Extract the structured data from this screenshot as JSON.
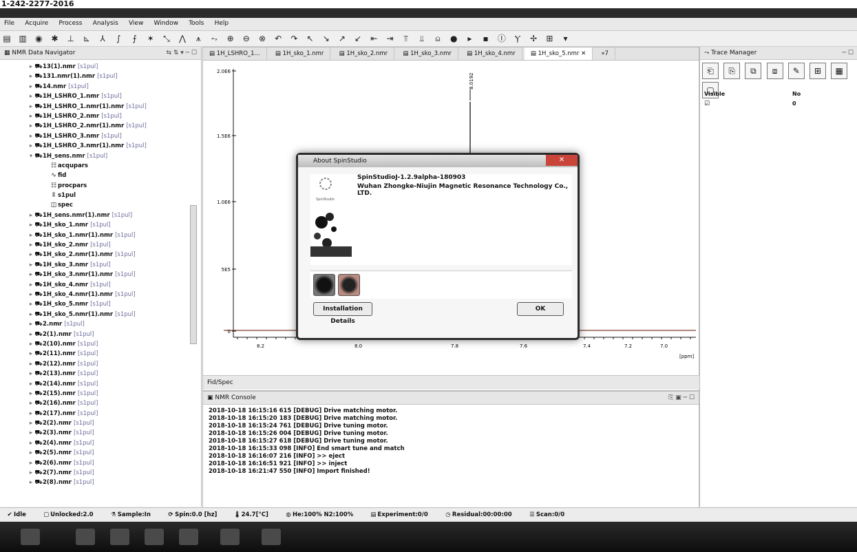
{
  "top_caption": "1-242-2277-2016",
  "menu": [
    "File",
    "Acquire",
    "Process",
    "Analysis",
    "View",
    "Window",
    "Tools",
    "Help"
  ],
  "navigator": {
    "title": "NMR Data Navigator",
    "items": [
      {
        "label": "13(1).nmr",
        "suffix": "[s1pul]",
        "icon": "spectrum-file-icon"
      },
      {
        "label": "131.nmr(1).nmr",
        "suffix": "[s1pul]",
        "icon": "spectrum-file-icon"
      },
      {
        "label": "14.nmr",
        "suffix": "[s1pul]",
        "icon": "spectrum-file-icon"
      },
      {
        "label": "1H_LSHRO_1.nmr",
        "suffix": "[s1pul]",
        "icon": "spectrum-file-icon"
      },
      {
        "label": "1H_LSHRO_1.nmr(1).nmr",
        "suffix": "[s1pul]",
        "icon": "spectrum-file-icon"
      },
      {
        "label": "1H_LSHRO_2.nmr",
        "suffix": "[s1pul]",
        "icon": "spectrum-file-icon"
      },
      {
        "label": "1H_LSHRO_2.nmr(1).nmr",
        "suffix": "[s1pul]",
        "icon": "spectrum-file-icon"
      },
      {
        "label": "1H_LSHRO_3.nmr",
        "suffix": "[s1pul]",
        "icon": "spectrum-file-icon"
      },
      {
        "label": "1H_LSHRO_3.nmr(1).nmr",
        "suffix": "[s1pul]",
        "icon": "spectrum-file-icon"
      },
      {
        "label": "1H_sens.nmr",
        "suffix": "[s1pul]",
        "icon": "spectrum-file-icon"
      },
      {
        "label": "acqupars",
        "suffix": "",
        "icon": "params-icon"
      },
      {
        "label": "fid",
        "suffix": "",
        "icon": "fid-icon"
      },
      {
        "label": "procpars",
        "suffix": "",
        "icon": "params-icon"
      },
      {
        "label": "s1pul",
        "suffix": "",
        "icon": "pulse-icon"
      },
      {
        "label": "spec",
        "suffix": "",
        "icon": "spectrum-icon"
      },
      {
        "label": "1H_sens.nmr(1).nmr",
        "suffix": "[s1pul]",
        "icon": "spectrum-file-icon"
      },
      {
        "label": "1H_sko_1.nmr",
        "suffix": "[s1pul]",
        "icon": "spectrum-file-icon"
      },
      {
        "label": "1H_sko_1.nmr(1).nmr",
        "suffix": "[s1pul]",
        "icon": "spectrum-file-icon"
      },
      {
        "label": "1H_sko_2.nmr",
        "suffix": "[s1pul]",
        "icon": "spectrum-file-icon"
      },
      {
        "label": "1H_sko_2.nmr(1).nmr",
        "suffix": "[s1pul]",
        "icon": "spectrum-file-icon"
      },
      {
        "label": "1H_sko_3.nmr",
        "suffix": "[s1pul]",
        "icon": "spectrum-file-icon"
      },
      {
        "label": "1H_sko_3.nmr(1).nmr",
        "suffix": "[s1pul]",
        "icon": "spectrum-file-icon"
      },
      {
        "label": "1H_sko_4.nmr",
        "suffix": "[s1pul]",
        "icon": "spectrum-file-icon"
      },
      {
        "label": "1H_sko_4.nmr(1).nmr",
        "suffix": "[s1pul]",
        "icon": "spectrum-file-icon"
      },
      {
        "label": "1H_sko_5.nmr",
        "suffix": "[s1pul]",
        "icon": "spectrum-file-icon"
      },
      {
        "label": "1H_sko_5.nmr(1).nmr",
        "suffix": "[s1pul]",
        "icon": "spectrum-file-icon"
      },
      {
        "label": "2.nmr",
        "suffix": "[s1pul]",
        "icon": "spectrum-file-icon"
      },
      {
        "label": "2(1).nmr",
        "suffix": "[s1pul]",
        "icon": "spectrum-file-icon"
      },
      {
        "label": "2(10).nmr",
        "suffix": "[s1pul]",
        "icon": "spectrum-file-icon"
      },
      {
        "label": "2(11).nmr",
        "suffix": "[s1pul]",
        "icon": "spectrum-file-icon"
      },
      {
        "label": "2(12).nmr",
        "suffix": "[s1pul]",
        "icon": "spectrum-file-icon"
      },
      {
        "label": "2(13).nmr",
        "suffix": "[s1pul]",
        "icon": "spectrum-file-icon"
      },
      {
        "label": "2(14).nmr",
        "suffix": "[s1pul]",
        "icon": "spectrum-file-icon"
      },
      {
        "label": "2(15).nmr",
        "suffix": "[s1pul]",
        "icon": "spectrum-file-icon"
      },
      {
        "label": "2(16).nmr",
        "suffix": "[s1pul]",
        "icon": "spectrum-file-icon"
      },
      {
        "label": "2(17).nmr",
        "suffix": "[s1pul]",
        "icon": "spectrum-file-icon"
      },
      {
        "label": "2(2).nmr",
        "suffix": "[s1pul]",
        "icon": "spectrum-file-icon"
      },
      {
        "label": "2(3).nmr",
        "suffix": "[s1pul]",
        "icon": "spectrum-file-icon"
      },
      {
        "label": "2(4).nmr",
        "suffix": "[s1pul]",
        "icon": "spectrum-file-icon"
      },
      {
        "label": "2(5).nmr",
        "suffix": "[s1pul]",
        "icon": "spectrum-file-icon"
      },
      {
        "label": "2(6).nmr",
        "suffix": "[s1pul]",
        "icon": "spectrum-file-icon"
      },
      {
        "label": "2(7).nmr",
        "suffix": "[s1pul]",
        "icon": "spectrum-file-icon"
      },
      {
        "label": "2(8).nmr",
        "suffix": "[s1pul]",
        "icon": "spectrum-file-icon"
      }
    ]
  },
  "tabs": [
    "1H_LSHRO_1...",
    "1H_sko_1.nmr",
    "1H_sko_2.nmr",
    "1H_sko_3.nmr",
    "1H_sko_4.nmr",
    "1H_sko_5.nmr"
  ],
  "tab_overflow": "»7",
  "plot": {
    "y_ticks": [
      "2.0E6",
      "1.5E6",
      "1.0E6",
      "5E5",
      "0"
    ],
    "x_ticks": [
      "8.2",
      "8.0",
      "7.8",
      "7.6",
      "7.4",
      "7.2",
      "7.0"
    ],
    "x_unit": "[ppm]",
    "peak_label": "8.0192"
  },
  "plot_footer": "Fid/Spec",
  "dialog": {
    "title": "About SpinStudio",
    "version": "SpinStudioJ-1.2.9alpha-180903",
    "company": "Wuhan Zhongke-Niujin Magnetic Resonance Technology Co., LTD.",
    "logo_caption": "SpinStudio",
    "details_button": "Installation Details",
    "ok_button": "OK"
  },
  "console": {
    "title": "NMR Console",
    "lines": [
      "2018-10-18 16:15:16 615 [DEBUG] Drive matching motor.",
      "2018-10-18 16:15:20 183 [DEBUG] Drive matching motor.",
      "2018-10-18 16:15:24 761 [DEBUG] Drive tuning motor.",
      "2018-10-18 16:15:26 004 [DEBUG] Drive tuning motor.",
      "2018-10-18 16:15:27 618 [DEBUG] Drive tuning motor.",
      "2018-10-18 16:15:33 098 [INFO] End smart tune and match",
      "2018-10-18 16:16:07 216 [INFO] >> eject",
      "2018-10-18 16:16:51 921 [INFO] >> inject",
      "2018-10-18 16:21:47 550 [INFO] Import finished!"
    ]
  },
  "trace": {
    "title": "Trace Manager",
    "col_visible": "Visible",
    "col_no": "No",
    "row_no": "0"
  },
  "status": [
    {
      "icon": "idle-icon",
      "label": "Idle"
    },
    {
      "icon": "lock-icon",
      "label": "Unlocked:2.0"
    },
    {
      "icon": "sample-icon",
      "label": "Sample:In"
    },
    {
      "icon": "spin-icon",
      "label": "Spin:0.0 [hz]"
    },
    {
      "icon": "temperature-icon",
      "label": "24.7[°C]"
    },
    {
      "icon": "helium-icon",
      "label": "He:100% N2:100%"
    },
    {
      "icon": "experiment-icon",
      "label": "Experiment:0/0"
    },
    {
      "icon": "clock-icon",
      "label": "Residual:00:00:00"
    },
    {
      "icon": "scan-icon",
      "label": "Scan:0/0"
    }
  ],
  "colors": {
    "accent": "#c9453a",
    "spectrum": "#111111",
    "baseline": "#7a3d2e"
  }
}
